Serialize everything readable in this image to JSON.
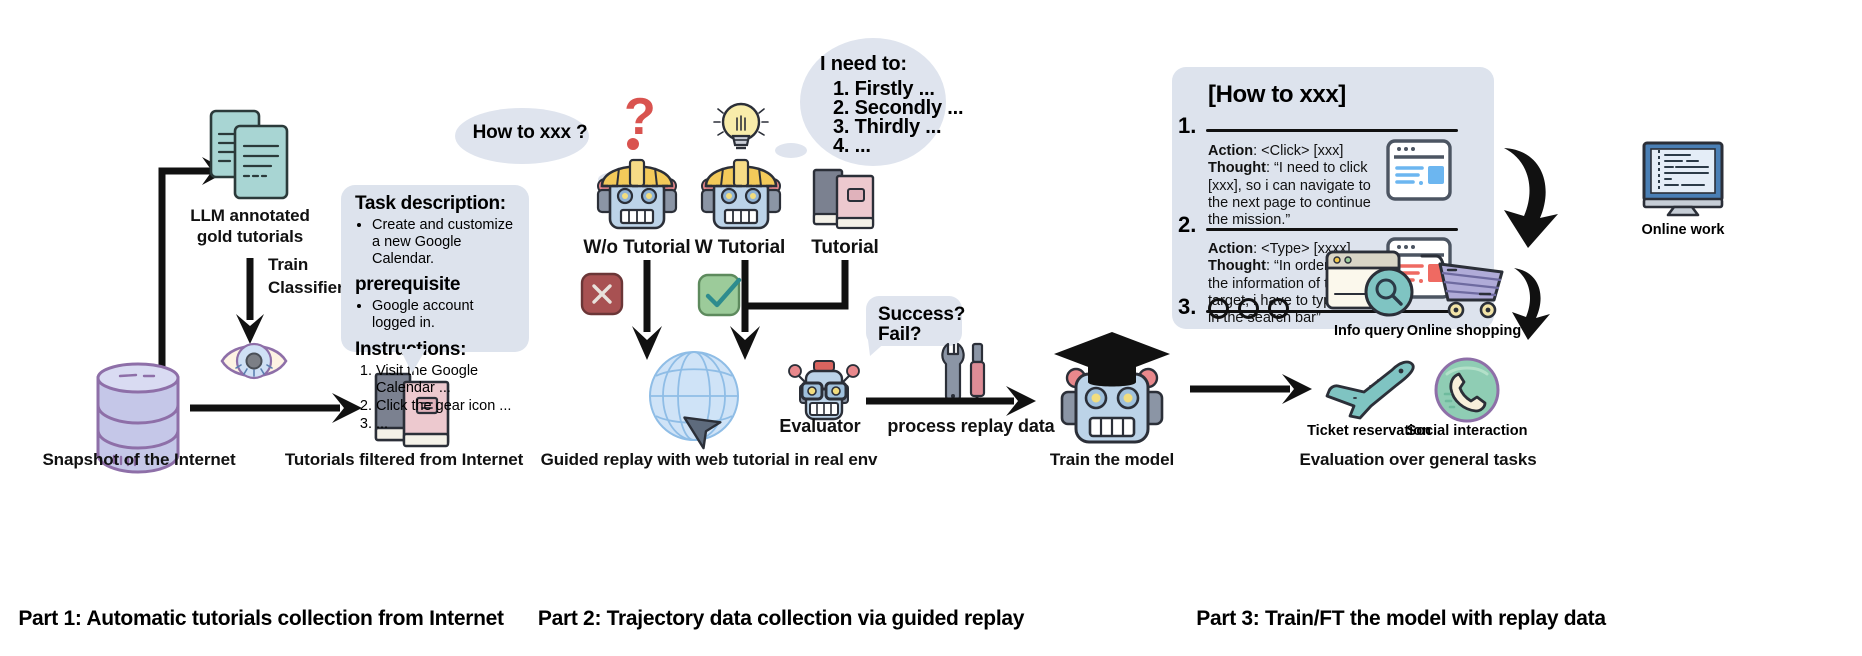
{
  "parts": [
    {
      "id": "part1",
      "caption": "Part 1: Automatic tutorials collection from Internet"
    },
    {
      "id": "part2",
      "caption": "Part 2: Trajectory data collection via guided replay"
    },
    {
      "id": "part3",
      "caption": "Part 3: Train/FT the model with replay data"
    }
  ],
  "part1": {
    "gold_tutorials_label_line1": "LLM annotated",
    "gold_tutorials_label_line2": "gold tutorials",
    "train_label_line1": "Train",
    "train_label_line2": "Classifier",
    "snapshot_label": "Snapshot of the Internet",
    "filtered_label": "Tutorials filtered from Internet",
    "task_card": {
      "title": "Task description:",
      "task_items": [
        "Create and customize a new Google Calendar."
      ],
      "prereq_title": "prerequisite",
      "prereq_items": [
        "Google account logged in."
      ],
      "instructions_title": "Instructions:",
      "instructions": [
        "Visit the Google Calendar ...",
        "Click the gear icon ...",
        "..."
      ]
    }
  },
  "part2": {
    "how_to_bubble": "How to xxx ?",
    "need_bubble": {
      "header": "I need to:",
      "items": [
        "1. Firstly ...",
        "2. Secondly ...",
        "3. Thirdly ...",
        "4. ..."
      ]
    },
    "robot_wo_label": "W/o Tutorial",
    "robot_w_label": "W Tutorial",
    "tutorial_label": "Tutorial",
    "success_bubble_line1": "Success?",
    "success_bubble_line2": "Fail?",
    "evaluator_label": "Evaluator",
    "process_label": "process replay data",
    "guided_replay_label": "Guided replay with web tutorial in real env"
  },
  "part3": {
    "howto_title": "[How to xxx]",
    "steps": [
      {
        "num": "1.",
        "action_key": "Action",
        "action_val": ": <Click> [xxx]",
        "thought_key": "Thought",
        "thought_val": ": “I need to click [xxx], so i can navigate to the next page to continue the mission.”",
        "accent": "#6cb6f0"
      },
      {
        "num": "2.",
        "action_key": "Action",
        "action_val": ": <Type> [xxxx]",
        "thought_key": "Thought",
        "thought_val": ": “In order to find the information of the target, i have to type [xxxx] in the search bar”",
        "accent": "#ef6a62"
      },
      {
        "num": "3.",
        "action_key": "",
        "action_val": "",
        "thought_key": "",
        "thought_val": "",
        "accent": ""
      }
    ],
    "train_label": "Train the model",
    "eval_label": "Evaluation over general tasks",
    "apps": [
      {
        "name": "Online work",
        "icon": "monitor-icon"
      },
      {
        "name": "Info query",
        "icon": "browser-search-icon"
      },
      {
        "name": "Online shopping",
        "icon": "shopping-cart-icon"
      },
      {
        "name": "Ticket reservation",
        "icon": "airplane-icon"
      },
      {
        "name": "Social interaction",
        "icon": "phone-chat-icon"
      }
    ]
  },
  "colors": {
    "bubble_bg": "#dfe4ee",
    "card_bg": "#dde3ed",
    "doc_teal": "#a8d5d3",
    "db_purple": "#c5c7e8",
    "book_pink": "#edc9cf",
    "helmet_yellow": "#f3ca5a",
    "robot_body": "#bcd3e8",
    "fail_red": "#a85152",
    "pass_green": "#9ccb9a",
    "globe_blue": "#cfe3f7",
    "accent_blue": "#6cb6f0",
    "accent_red": "#ef6a62",
    "teal": "#7fc4c2",
    "line": "#111111"
  }
}
